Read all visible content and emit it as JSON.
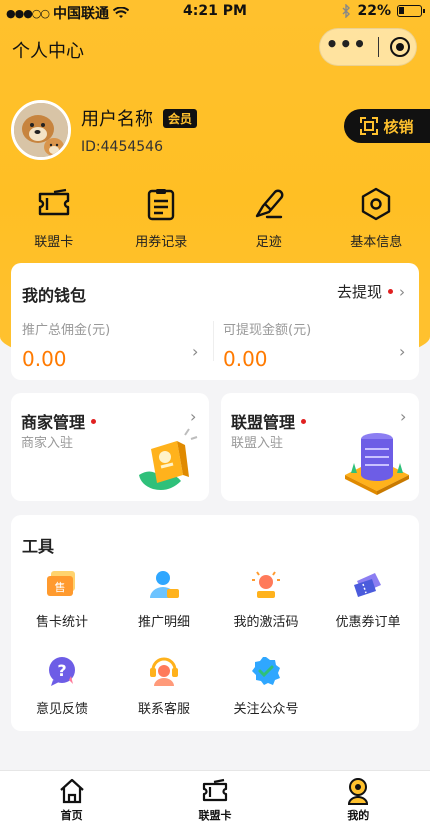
{
  "status_bar": {
    "carrier": "中国联通",
    "time": "4:21 PM",
    "battery": "22%"
  },
  "nav": {
    "title": "个人中心"
  },
  "profile": {
    "username": "用户名称",
    "badge": "会员",
    "user_id": "ID:4454546"
  },
  "verify_button": {
    "label": "核销"
  },
  "quick_menu": [
    {
      "label": "联盟卡",
      "icon": "ticket-icon"
    },
    {
      "label": "用券记录",
      "icon": "document-list-icon"
    },
    {
      "label": "足迹",
      "icon": "footprint-icon"
    },
    {
      "label": "基本信息",
      "icon": "hexagon-settings-icon"
    }
  ],
  "wallet": {
    "title": "我的钱包",
    "withdraw_label": "去提现",
    "total_commission_label": "推广总佣金(元)",
    "total_commission_value": "0.00",
    "withdrawable_label": "可提现金额(元)",
    "withdrawable_value": "0.00"
  },
  "merchant": {
    "title": "商家管理",
    "subtitle": "商家入驻"
  },
  "alliance": {
    "title": "联盟管理",
    "subtitle": "联盟入驻"
  },
  "tools": {
    "title": "工具",
    "items": [
      {
        "label": "售卡统计",
        "icon": "card-sale-icon",
        "badge_text": "售"
      },
      {
        "label": "推广明细",
        "icon": "user-promo-icon"
      },
      {
        "label": "我的激活码",
        "icon": "lightbulb-icon"
      },
      {
        "label": "优惠券订单",
        "icon": "coupon-icon"
      },
      {
        "label": "意见反馈",
        "icon": "question-bubble-icon"
      },
      {
        "label": "联系客服",
        "icon": "headset-icon"
      },
      {
        "label": "关注公众号",
        "icon": "verified-check-icon"
      }
    ]
  },
  "tabbar": [
    {
      "label": "首页",
      "icon": "home-icon"
    },
    {
      "label": "联盟卡",
      "icon": "ticket-icon"
    },
    {
      "label": "我的",
      "icon": "user-icon"
    }
  ],
  "colors": {
    "brand_yellow": "#ffc12e",
    "dark": "#111111",
    "amount_orange": "#ff7a00",
    "dot_red": "#e02020"
  }
}
